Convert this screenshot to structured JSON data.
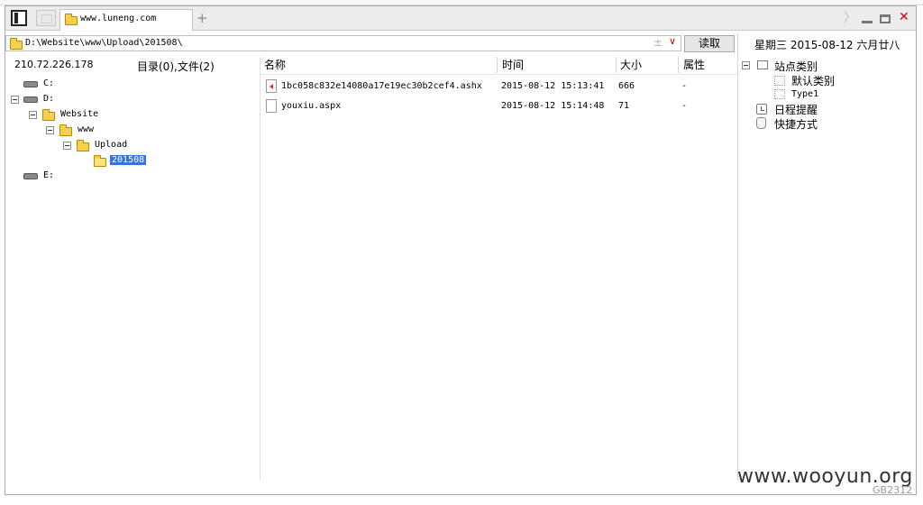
{
  "tab": {
    "label": "www.luneng.com",
    "new_tab_glyph": "+"
  },
  "window_controls": {
    "forward": "〉",
    "close": "✕"
  },
  "address": {
    "path": "D:\\Website\\www\\Upload\\201508\\",
    "plus": "±",
    "dropdown": "∨",
    "read_button": "读取"
  },
  "date_line": "星期三  2015-08-12  六月廿八",
  "left_panel": {
    "ip": "210.72.226.178",
    "dir_count": "目录(0),文件(2)",
    "tree": [
      {
        "label": "C:",
        "type": "drive"
      },
      {
        "label": "D:",
        "type": "drive"
      },
      {
        "label": "Website",
        "type": "folder"
      },
      {
        "label": "www",
        "type": "folder"
      },
      {
        "label": "Upload",
        "type": "folder"
      },
      {
        "label": "201508",
        "type": "folder",
        "selected": true
      },
      {
        "label": "E:",
        "type": "drive"
      }
    ]
  },
  "file_list": {
    "headers": {
      "name": "名称",
      "time": "时间",
      "size": "大小",
      "attr": "属性"
    },
    "rows": [
      {
        "name": "1bc058c832e14080a17e19ec30b2cef4.ashx",
        "time": "2015-08-12 15:13:41",
        "size": "666",
        "attr": "-",
        "icon": "ashx-file-icon"
      },
      {
        "name": "youxiu.aspx",
        "time": "2015-08-12 15:14:48",
        "size": "71",
        "attr": "-",
        "icon": "file-icon"
      }
    ]
  },
  "right_panel": {
    "site_category": "站点类别",
    "default_category": "默认类别",
    "type1": "Type1",
    "schedule": "日程提醒",
    "shortcuts": "快捷方式"
  },
  "watermark": {
    "main": "www.wooyun.org",
    "sub": "GB2312"
  },
  "colors": {
    "selection": "#3875d7",
    "folder": "#f6d04d",
    "close": "#d40000"
  }
}
